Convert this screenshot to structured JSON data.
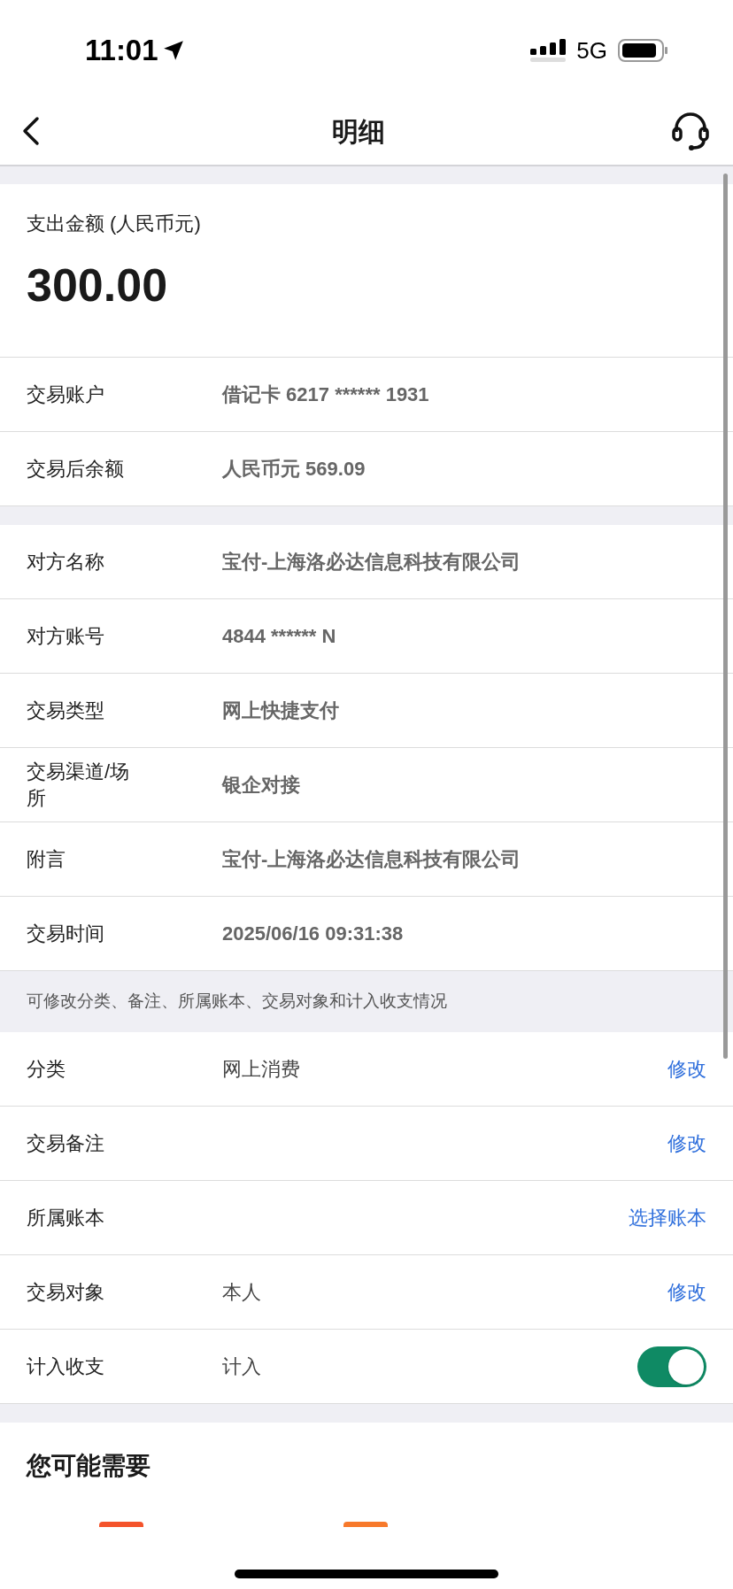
{
  "status_bar": {
    "time": "11:01",
    "network": "5G"
  },
  "nav": {
    "title": "明细"
  },
  "amount": {
    "label": "支出金额 (人民币元)",
    "value": "300.00"
  },
  "sections": [
    {
      "rows": [
        {
          "kind": "text",
          "label": "交易账户",
          "value": "借记卡 6217 ****** 1931"
        },
        {
          "kind": "text",
          "label": "交易后余额",
          "value": "人民币元 569.09"
        }
      ]
    },
    {
      "rows": [
        {
          "kind": "text",
          "label": "对方名称",
          "value": "宝付-上海洛必达信息科技有限公司"
        },
        {
          "kind": "text",
          "label": "对方账号",
          "value": "4844 ****** N"
        },
        {
          "kind": "text",
          "label": "交易类型",
          "value": "网上快捷支付"
        },
        {
          "kind": "text",
          "label": "交易渠道/场所",
          "value": "银企对接"
        },
        {
          "kind": "text",
          "label": "附言",
          "value": "宝付-上海洛必达信息科技有限公司"
        },
        {
          "kind": "text",
          "label": "交易时间",
          "value": "2025/06/16 09:31:38"
        }
      ]
    },
    {
      "hint": "可修改分类、备注、所属账本、交易对象和计入收支情况",
      "rows": [
        {
          "kind": "action",
          "label": "分类",
          "value": "网上消费",
          "action": "修改"
        },
        {
          "kind": "action",
          "label": "交易备注",
          "action": "修改"
        },
        {
          "kind": "action",
          "label": "所属账本",
          "action": "选择账本"
        },
        {
          "kind": "action",
          "label": "交易对象",
          "value": "本人",
          "action": "修改"
        },
        {
          "kind": "toggle",
          "label": "计入收支",
          "value": "计入",
          "on": true
        }
      ]
    }
  ],
  "suggestions": {
    "title": "您可能需要",
    "items": [
      {
        "color": "#f4532b"
      },
      {
        "color": "#f7792b"
      }
    ]
  }
}
